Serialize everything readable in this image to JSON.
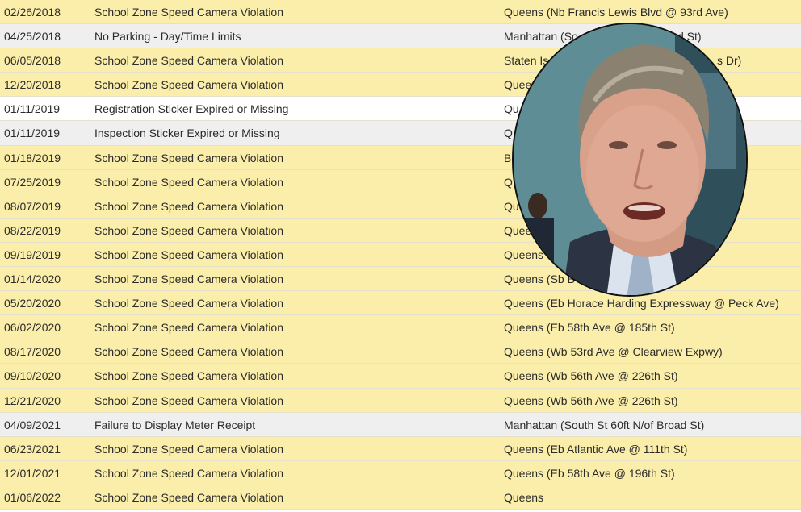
{
  "violations": [
    {
      "date": "02/26/2018",
      "violation": "School Zone Speed Camera Violation",
      "location": "Queens (Nb Francis Lewis Blvd @ 93rd Ave)",
      "shade": "yellow"
    },
    {
      "date": "04/25/2018",
      "violation": "No Parking - Day/Time Limits",
      "location": "Manhattan (So",
      "location_tail": "d St)",
      "shade": "gray"
    },
    {
      "date": "06/05/2018",
      "violation": "School Zone Speed Camera Violation",
      "location": "Staten Is",
      "location_tail": "s Dr)",
      "shade": "yellow"
    },
    {
      "date": "12/20/2018",
      "violation": "School Zone Speed Camera Violation",
      "location": "Quee",
      "shade": "yellow"
    },
    {
      "date": "01/11/2019",
      "violation": "Registration Sticker Expired or Missing",
      "location": "Qu",
      "shade": "white"
    },
    {
      "date": "01/11/2019",
      "violation": "Inspection Sticker Expired or Missing",
      "location": "Q",
      "shade": "gray"
    },
    {
      "date": "01/18/2019",
      "violation": "School Zone Speed Camera Violation",
      "location": "B",
      "shade": "yellow"
    },
    {
      "date": "07/25/2019",
      "violation": "School Zone Speed Camera Violation",
      "location": "Q",
      "shade": "yellow"
    },
    {
      "date": "08/07/2019",
      "violation": "School Zone Speed Camera Violation",
      "location": "Qu",
      "shade": "yellow"
    },
    {
      "date": "08/22/2019",
      "violation": "School Zone Speed Camera Violation",
      "location": "Quee",
      "shade": "yellow"
    },
    {
      "date": "09/19/2019",
      "violation": "School Zone Speed Camera Violation",
      "location": "Queens",
      "shade": "yellow"
    },
    {
      "date": "01/14/2020",
      "violation": "School Zone Speed Camera Violation",
      "location": "Queens (Sb B",
      "shade": "yellow"
    },
    {
      "date": "05/20/2020",
      "violation": "School Zone Speed Camera Violation",
      "location": "Queens (Eb Horace Harding Expressway @ Peck Ave)",
      "shade": "yellow"
    },
    {
      "date": "06/02/2020",
      "violation": "School Zone Speed Camera Violation",
      "location": "Queens (Eb 58th Ave @ 185th St)",
      "shade": "yellow"
    },
    {
      "date": "08/17/2020",
      "violation": "School Zone Speed Camera Violation",
      "location": "Queens (Wb 53rd Ave @ Clearview Expwy)",
      "shade": "yellow"
    },
    {
      "date": "09/10/2020",
      "violation": "School Zone Speed Camera Violation",
      "location": "Queens (Wb 56th Ave @ 226th St)",
      "shade": "yellow"
    },
    {
      "date": "12/21/2020",
      "violation": "School Zone Speed Camera Violation",
      "location": "Queens (Wb 56th Ave @ 226th St)",
      "shade": "yellow"
    },
    {
      "date": "04/09/2021",
      "violation": "Failure to Display Meter Receipt",
      "location": "Manhattan (South St 60ft N/of Broad St)",
      "shade": "gray"
    },
    {
      "date": "06/23/2021",
      "violation": "School Zone Speed Camera Violation",
      "location": "Queens (Eb Atlantic Ave @ 111th St)",
      "shade": "yellow"
    },
    {
      "date": "12/01/2021",
      "violation": "School Zone Speed Camera Violation",
      "location": "Queens (Eb 58th Ave @ 196th St)",
      "shade": "yellow"
    },
    {
      "date": "01/06/2022",
      "violation": "School Zone Speed Camera Violation",
      "location": "Queens",
      "shade": "yellow"
    }
  ],
  "colors": {
    "yellow_row": "#fbeeaa",
    "gray_row": "#efefef",
    "white_row": "#ffffff",
    "text": "#2b2b2b"
  },
  "overlay": {
    "icon": "portrait-photo"
  }
}
